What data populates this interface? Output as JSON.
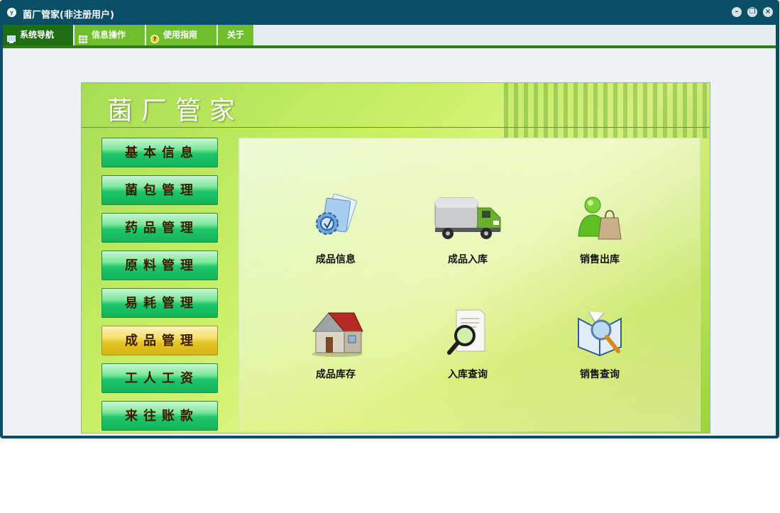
{
  "window": {
    "app_icon_letter": "y",
    "title": "菌厂管家(非注册用户)",
    "controls": [
      "minimize-icon",
      "restore-icon",
      "close-icon"
    ]
  },
  "menu": {
    "tabs": [
      {
        "label": "系统导航",
        "icon": "monitor-icon",
        "active": true
      },
      {
        "label": "信息操作",
        "icon": "grid-icon",
        "active": false
      },
      {
        "label": "使用指南",
        "icon": "help-icon",
        "active": false
      },
      {
        "label": "关于",
        "icon": "",
        "active": false
      }
    ]
  },
  "panel": {
    "title": "菌厂管家"
  },
  "nav": {
    "items": [
      {
        "label": "基本信息",
        "active": false
      },
      {
        "label": "菌包管理",
        "active": false
      },
      {
        "label": "药品管理",
        "active": false
      },
      {
        "label": "原料管理",
        "active": false
      },
      {
        "label": "易耗管理",
        "active": false
      },
      {
        "label": "成品管理",
        "active": true
      },
      {
        "label": "工人工资",
        "active": false
      },
      {
        "label": "来往账款",
        "active": false
      }
    ]
  },
  "tiles": [
    {
      "label": "成品信息",
      "icon": "document-gear-icon"
    },
    {
      "label": "成品入库",
      "icon": "truck-icon"
    },
    {
      "label": "销售出库",
      "icon": "user-shopping-bag-icon"
    },
    {
      "label": "成品库存",
      "icon": "house-icon"
    },
    {
      "label": "入库查询",
      "icon": "magnifier-document-icon"
    },
    {
      "label": "销售查询",
      "icon": "magnifier-book-icon"
    }
  ],
  "colors": {
    "titlebar": "#0b4f66",
    "active_tab": "#1f6e14",
    "tab": "#6fbf2d",
    "nav_button": "#1ec66a",
    "nav_button_active": "#e3c323"
  }
}
